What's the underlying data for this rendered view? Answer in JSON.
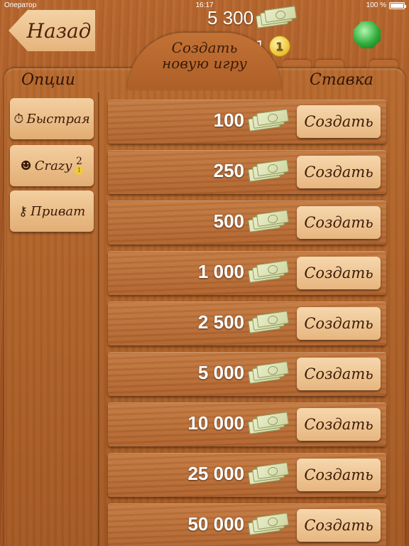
{
  "status_bar": {
    "carrier": "Оператор",
    "time": "16:17",
    "battery": "100 %"
  },
  "header": {
    "back_label": "Назад",
    "balance": "5 300",
    "coins": "1",
    "coin_symbol": "1",
    "tab_title_line1": "Создать",
    "tab_title_line2": "новую игру"
  },
  "options": {
    "title": "Опции",
    "items": [
      {
        "label": "Быстрая",
        "icon": "stopwatch-icon"
      },
      {
        "label": "Crazy",
        "icon": "crazy-face-icon",
        "count": "2",
        "coin": "1"
      },
      {
        "label": "Приват",
        "icon": "key-icon"
      }
    ]
  },
  "stakes": {
    "title": "Ставка",
    "create_label": "Создать",
    "rows": [
      {
        "amount": "100"
      },
      {
        "amount": "250"
      },
      {
        "amount": "500"
      },
      {
        "amount": "1 000"
      },
      {
        "amount": "2 500"
      },
      {
        "amount": "5 000"
      },
      {
        "amount": "10 000"
      },
      {
        "amount": "25 000"
      },
      {
        "amount": "50 000"
      }
    ]
  },
  "colors": {
    "wood": "#b0622c",
    "button": "#e7b67f",
    "text_dark": "#3a1b08"
  }
}
